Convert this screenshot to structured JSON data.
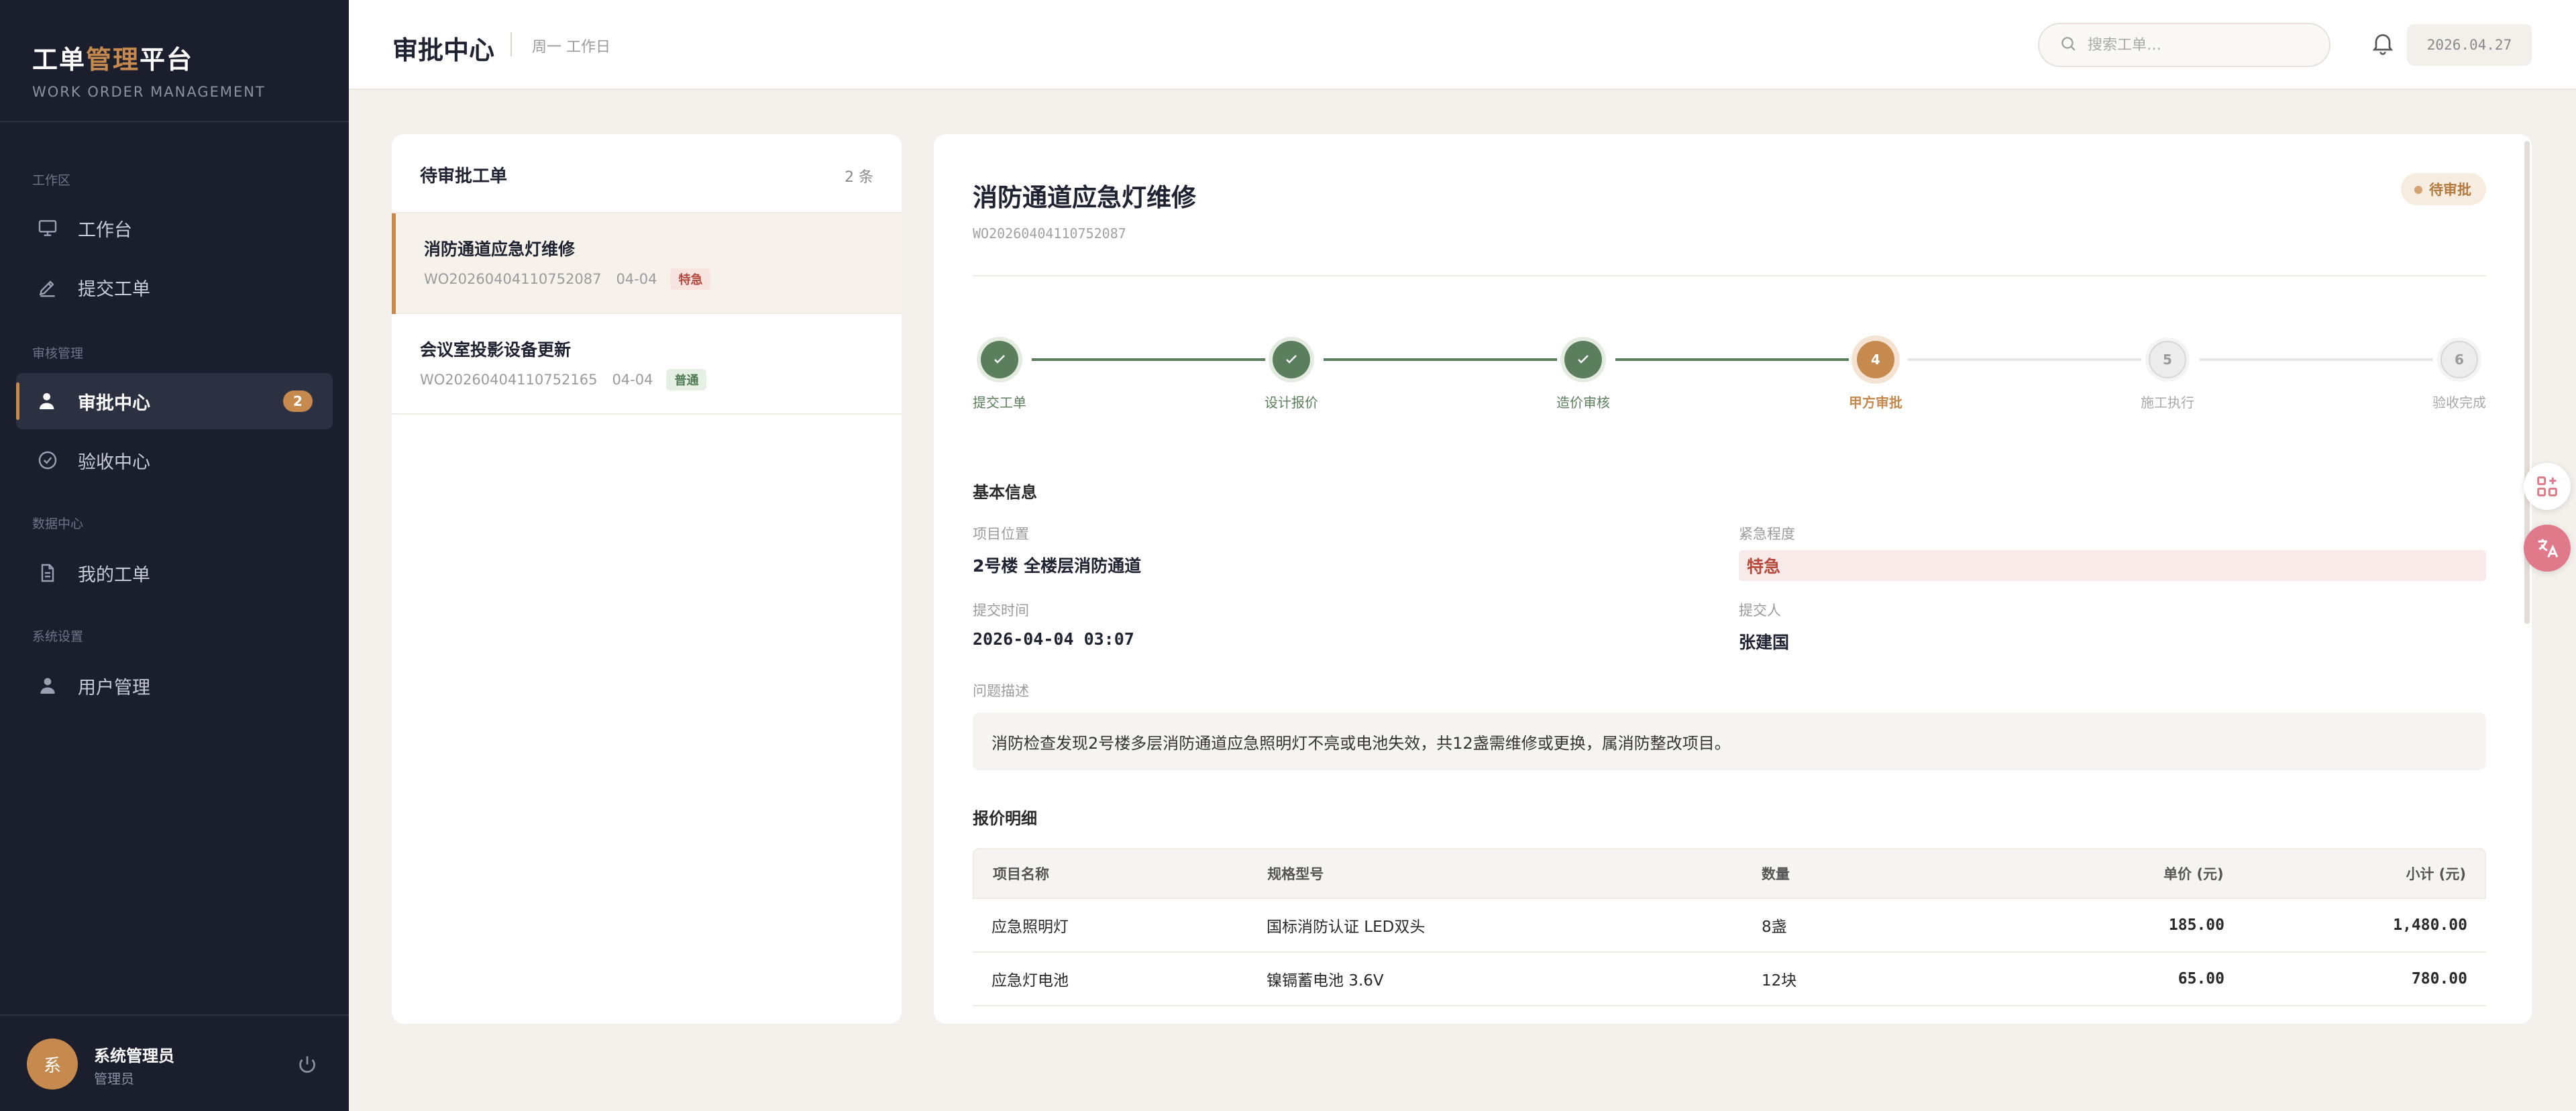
{
  "brand": {
    "title_a": "工单",
    "title_b": "管理",
    "title_c": "平台",
    "subtitle": "WORK ORDER MANAGEMENT"
  },
  "sidebar": {
    "sections": [
      "工作区",
      "审核管理",
      "数据中心",
      "系统设置"
    ],
    "items": [
      {
        "label": "工作台",
        "icon": "monitor-icon"
      },
      {
        "label": "提交工单",
        "icon": "pen-icon"
      },
      {
        "label": "审批中心",
        "icon": "user-check-icon",
        "badge": "2",
        "active": true
      },
      {
        "label": "验收中心",
        "icon": "check-circle-icon"
      },
      {
        "label": "我的工单",
        "icon": "document-icon"
      },
      {
        "label": "用户管理",
        "icon": "user-icon"
      }
    ]
  },
  "user": {
    "avatar": "系",
    "name": "系统管理员",
    "role": "管理员"
  },
  "header": {
    "title": "审批中心",
    "subtitle": "周一 工作日",
    "search_placeholder": "搜索工单…",
    "date": "2026.04.27"
  },
  "list": {
    "title": "待审批工单",
    "count": "2 条",
    "items": [
      {
        "title": "消防通道应急灯维修",
        "code": "WO20260404110752087",
        "date": "04-04",
        "tag": "特急"
      },
      {
        "title": "会议室投影设备更新",
        "code": "WO20260404110752165",
        "date": "04-04",
        "tag": "普通"
      }
    ]
  },
  "detail": {
    "title": "消防通道应急灯维修",
    "code": "WO20260404110752087",
    "status": "待审批",
    "steps": [
      {
        "n": "1",
        "label": "提交工单",
        "state": "done"
      },
      {
        "n": "2",
        "label": "设计报价",
        "state": "done"
      },
      {
        "n": "3",
        "label": "造价审核",
        "state": "done"
      },
      {
        "n": "4",
        "label": "甲方审批",
        "state": "current"
      },
      {
        "n": "5",
        "label": "施工执行",
        "state": "pending"
      },
      {
        "n": "6",
        "label": "验收完成",
        "state": "pending"
      }
    ],
    "basic_title": "基本信息",
    "location_label": "项目位置",
    "location": "2号楼 全楼层消防通道",
    "urgency_label": "紧急程度",
    "urgency": "特急",
    "time_label": "提交时间",
    "time": "2026-04-04 03:07",
    "submitter_label": "提交人",
    "submitter": "张建国",
    "desc_label": "问题描述",
    "desc": "消防检查发现2号楼多层消防通道应急照明灯不亮或电池失效，共12盏需维修或更换，属消防整改项目。",
    "quote_title": "报价明细",
    "table": {
      "headers": [
        "项目名称",
        "规格型号",
        "数量",
        "单价 (元)",
        "小计 (元)"
      ],
      "rows": [
        [
          "应急照明灯",
          "国标消防认证 LED双头",
          "8盏",
          "185.00",
          "1,480.00"
        ],
        [
          "应急灯电池",
          "镍镉蓄电池 3.6V",
          "12块",
          "65.00",
          "780.00"
        ]
      ]
    }
  },
  "colors": {
    "accent": "#c68a4f",
    "success": "#5b7f5d",
    "danger": "#b54a3d",
    "sidebar": "#1b1f2d"
  }
}
